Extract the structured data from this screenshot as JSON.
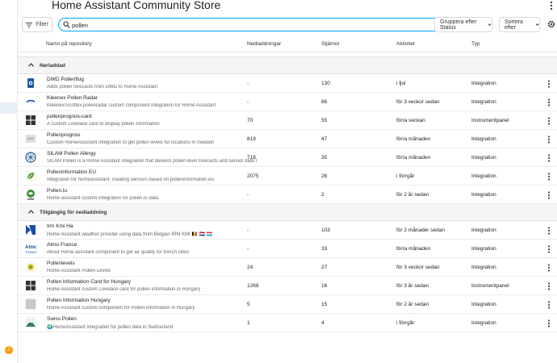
{
  "header": {
    "title": "Home Assistant Community Store"
  },
  "sidebar": {
    "notification_count": "2"
  },
  "filterbar": {
    "filter_label": "Filter",
    "search_value": "pollen",
    "group_label": "Gruppera efter Status",
    "sort_label": "Sortera efter"
  },
  "table": {
    "columns": {
      "name": "Namn på repository",
      "downloads": "Nedladdningar",
      "stars": "Stjärnor",
      "activity": "Aktivitet",
      "type": "Typ"
    }
  },
  "groups": {
    "downloaded": "Nerladdad",
    "available": "Tillgänglig för nedladdning"
  },
  "rows": [
    {
      "name": "DWD Pollenflug",
      "desc": "Adds pollen forecasts from DWD to Home Assistant",
      "downloads": "-",
      "stars": "130",
      "activity": "i fjol",
      "type": "Integration",
      "icon": "dwd-logo"
    },
    {
      "name": "Kleenex Pollen Radar",
      "desc": "Kleenex/Scottex pollenradar custom component integration for Home Assistant",
      "downloads": "-",
      "stars": "86",
      "activity": "för 3 veckor sedan",
      "type": "Integration",
      "icon": "kleenex-logo"
    },
    {
      "name": "pollenprognos-card",
      "desc": "A custom Lovelace card to display pollen information",
      "downloads": "70",
      "stars": "55",
      "activity": "förra veckan",
      "type": "Instrumentpanel",
      "icon": "dashboard-grid-icon"
    },
    {
      "name": "Pollenprognos",
      "desc": "Custom HomeAssistant integration to get pollen levels for locations in Sweden",
      "downloads": "819",
      "stars": "47",
      "activity": "förra månaden",
      "type": "Integration",
      "icon": "placeholder-icon"
    },
    {
      "name": "SILAM Pollen Allergy",
      "desc": "SILAM Pollen is a Home Assistant integration that delivers pollen level forecasts and sensor data f",
      "downloads": "718",
      "stars": "35",
      "activity": "förra månaden",
      "type": "Integration",
      "icon": "silam-logo"
    },
    {
      "name": "Polleninformation EU",
      "desc": "Integration for homeassistant, creating sensors based on polleninformation.eu",
      "downloads": "2075",
      "stars": "26",
      "activity": "i förrgår",
      "type": "Integration",
      "icon": "leaf-logo"
    },
    {
      "name": "Pollen.lu",
      "desc": "Home assistant custom integration for pollen.lu data",
      "downloads": "-",
      "stars": "2",
      "activity": "för 2 år sedan",
      "type": "Integration",
      "icon": "pollenlu-logo"
    },
    {
      "name": "Irm Kmi Ha",
      "desc": "Home Assistant weather provider using data from Belgian IRM KMI 🇧🇪 🇳🇱 🇱🇺",
      "downloads": "-",
      "stars": "103",
      "activity": "för 2 månader sedan",
      "type": "Integration",
      "icon": "irm-logo"
    },
    {
      "name": "Atmo France",
      "desc": "About Home assistant component to get air quality for french cities",
      "downloads": "-",
      "stars": "33",
      "activity": "förra månaden",
      "type": "Integration",
      "icon": "atmo-logo"
    },
    {
      "name": "Pollenlevels",
      "desc": "Home Assistant Pollen Levels",
      "downloads": "24",
      "stars": "27",
      "activity": "för 3 veckor sedan",
      "type": "Integration",
      "icon": "pollenlevels-logo"
    },
    {
      "name": "Pollen Information Card for Hungary",
      "desc": "Home Assistant custom Lovelace card for pollen information in Hungary",
      "downloads": "1268",
      "stars": "16",
      "activity": "för 3 år sedan",
      "type": "Instrumentpanel",
      "icon": "dashboard-grid-icon"
    },
    {
      "name": "Pollen Information Hungary",
      "desc": "Home Assistant custom component for Pollen Information in Hungary",
      "downloads": "5",
      "stars": "15",
      "activity": "för 2 år sedan",
      "type": "Integration",
      "icon": "hungary-grid-logo"
    },
    {
      "name": "Swiss Pollen",
      "desc": "🌍HomeAssistant integration for pollen data in Switzerland",
      "downloads": "1",
      "stars": "4",
      "activity": "i förrgår",
      "type": "Integration",
      "icon": "swiss-pollen-logo"
    }
  ],
  "colors": {
    "accent": "#03a9f4",
    "badge": "#ff9800",
    "group_bg": "#f5f5f5"
  }
}
